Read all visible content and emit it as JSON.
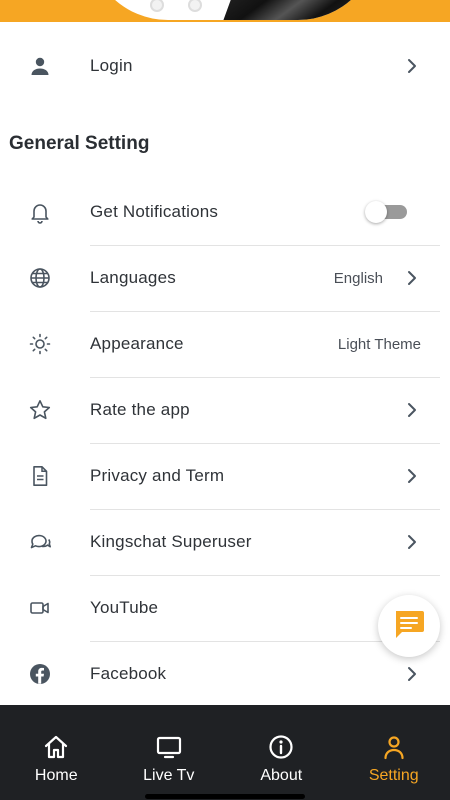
{
  "colors": {
    "accent": "#f6a623",
    "nav_bg": "#1f2124",
    "icon": "#4a5560"
  },
  "login": {
    "label": "Login",
    "icon": "person-icon"
  },
  "section_title": "General Setting",
  "settings": [
    {
      "label": "Get Notifications",
      "icon": "bell-icon",
      "toggle_on": false
    },
    {
      "label": "Languages",
      "icon": "globe-icon",
      "value": "English"
    },
    {
      "label": "Appearance",
      "icon": "sun-icon",
      "value": "Light Theme"
    },
    {
      "label": "Rate the app",
      "icon": "star-icon"
    },
    {
      "label": "Privacy and Term",
      "icon": "document-icon"
    },
    {
      "label": "Kingschat Superuser",
      "icon": "chat-bubbles-icon"
    },
    {
      "label": "YouTube",
      "icon": "video-camera-icon"
    },
    {
      "label": "Facebook",
      "icon": "facebook-icon"
    }
  ],
  "fab": {
    "icon": "chat-message-icon"
  },
  "nav": [
    {
      "label": "Home",
      "icon": "home-icon",
      "active": false
    },
    {
      "label": "Live Tv",
      "icon": "tv-icon",
      "active": false
    },
    {
      "label": "About",
      "icon": "info-icon",
      "active": false
    },
    {
      "label": "Setting",
      "icon": "user-icon",
      "active": true
    }
  ]
}
